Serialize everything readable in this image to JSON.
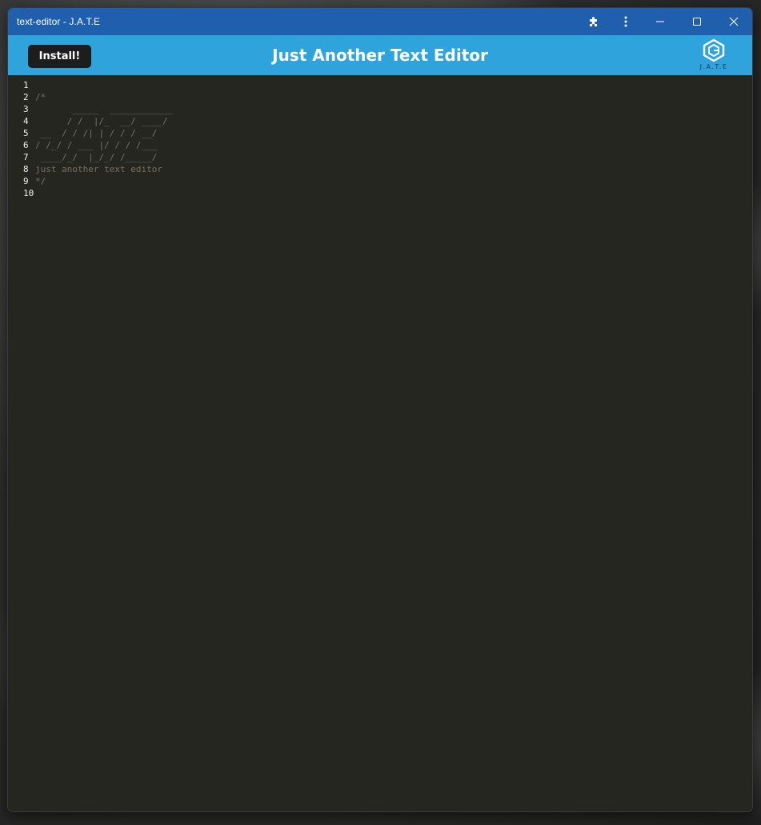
{
  "window": {
    "title": "text-editor - J.A.T.E"
  },
  "titlebar_icons": [
    {
      "icon": "puzzle-extension-icon"
    },
    {
      "icon": "more-vertical-icon"
    },
    {
      "icon": "minimize-icon"
    },
    {
      "icon": "maximize-icon"
    },
    {
      "icon": "close-icon"
    }
  ],
  "header": {
    "install_label": "Install!",
    "title": "Just Another Text Editor",
    "logo_text": "J.A.T.E",
    "accent_color": "#2fa4dc",
    "titlebar_color": "#1f5fae"
  },
  "editor": {
    "background": "#262621",
    "lines": [
      {
        "num": "1",
        "text": ""
      },
      {
        "num": "2",
        "text": "/*"
      },
      {
        "num": "3",
        "text": "       _____  ____________"
      },
      {
        "num": "4",
        "text": "      / /  |/_  __/ ____/"
      },
      {
        "num": "5",
        "text": " __  / / /| | / / / __/"
      },
      {
        "num": "6",
        "text": "/ /_/ / ___ |/ / / /___"
      },
      {
        "num": "7",
        "text": " ____/_/  |_/_/ /_____/"
      },
      {
        "num": "8",
        "text": "just another text editor"
      },
      {
        "num": "9",
        "text": "*/"
      },
      {
        "num": "10",
        "text": ""
      }
    ]
  }
}
